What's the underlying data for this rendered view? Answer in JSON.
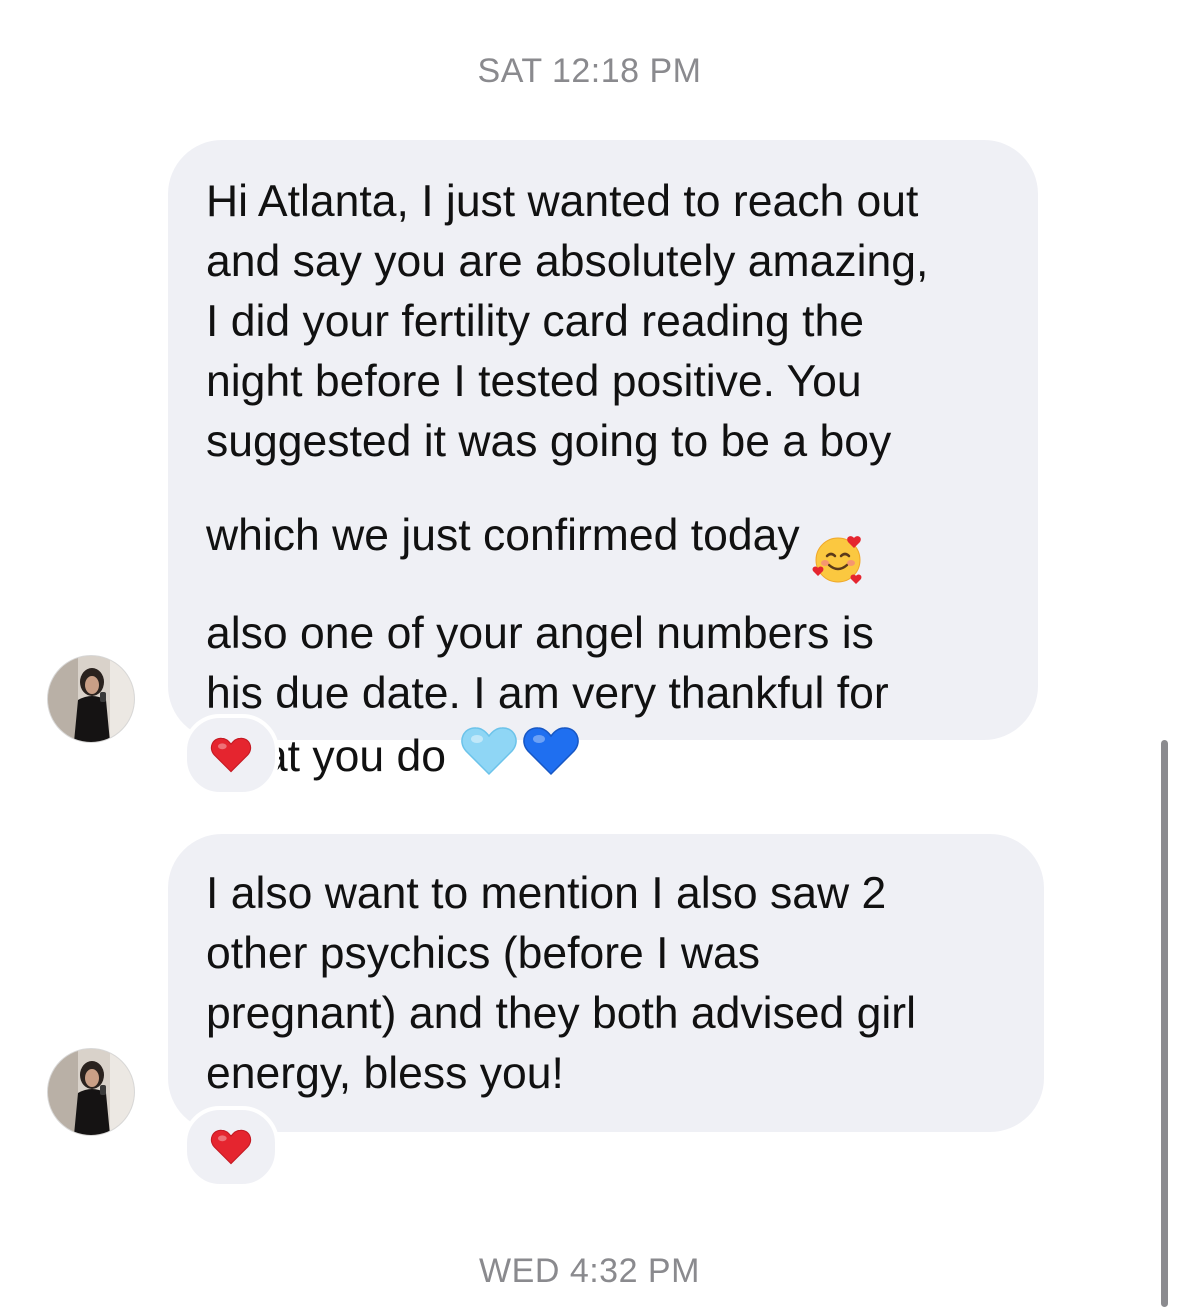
{
  "timestamps": {
    "top": "SAT 12:18 PM",
    "bottom": "WED 4:32 PM"
  },
  "messages": [
    {
      "lines": [
        "Hi Atlanta, I just wanted to reach out",
        "and say you are absolutely amazing,",
        "I did your fertility card reading the",
        "night before I tested positive. You",
        "suggested it was going to be a boy",
        "which we just confirmed today",
        "also one of your angel numbers is",
        "his due date. I am very thankful for",
        "what you do"
      ],
      "inline_emoji": [
        "smiling-face-with-hearts-icon",
        "light-blue-heart-icon",
        "blue-heart-icon"
      ],
      "reaction": "red-heart-icon"
    },
    {
      "lines": [
        "I also want to mention I also saw 2",
        "other psychics (before I was",
        "pregnant) and they both advised girl",
        "energy, bless you!"
      ],
      "reaction": "red-heart-icon"
    }
  ],
  "colors": {
    "bubble": "#eff0f5",
    "timestamp": "#8a8a8e",
    "heart_red": "#e5252f",
    "heart_light_blue": "#8fd6f5",
    "heart_blue": "#1f6ff0"
  }
}
